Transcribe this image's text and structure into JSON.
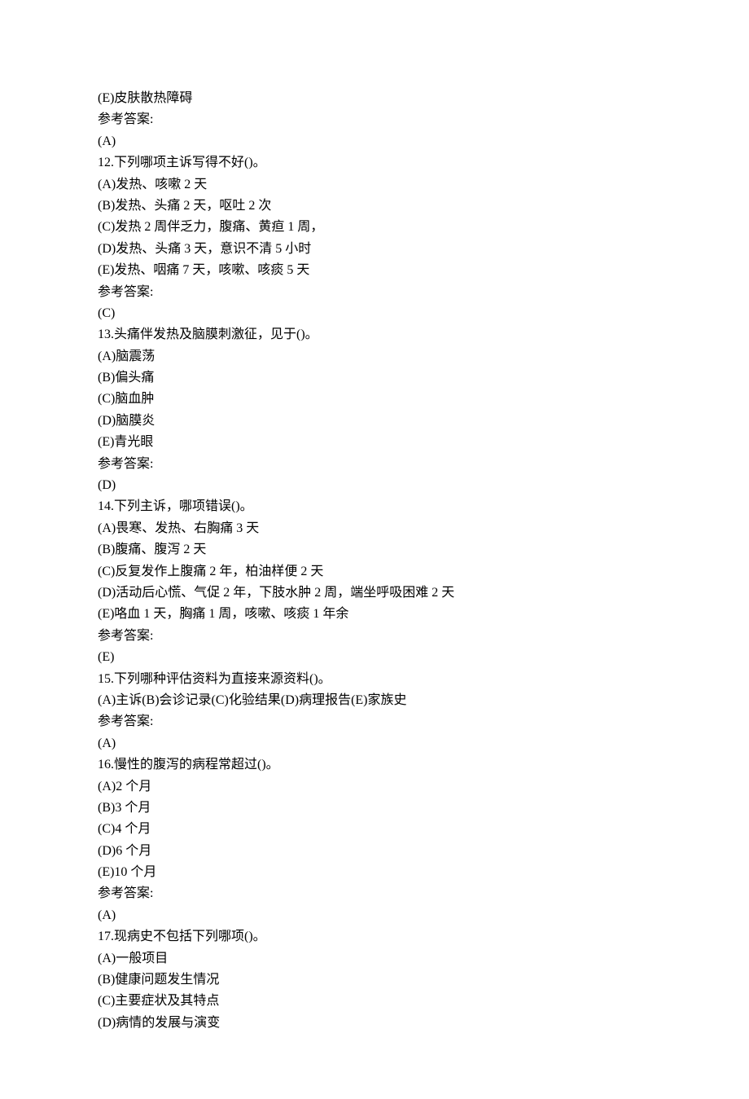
{
  "lines": [
    "(E)皮肤散热障碍",
    "参考答案:",
    "(A)",
    "12.下列哪项主诉写得不好()。",
    "(A)发热、咳嗽 2 天",
    "(B)发热、头痛 2 天，呕吐 2 次",
    "(C)发热 2 周伴乏力，腹痛、黄疸 1 周，",
    "(D)发热、头痛 3 天，意识不清 5 小时",
    "(E)发热、咽痛 7 天，咳嗽、咳痰 5 天",
    "参考答案:",
    "(C)",
    "13.头痛伴发热及脑膜刺激征，见于()。",
    "(A)脑震荡",
    "(B)偏头痛",
    "(C)脑血肿",
    "(D)脑膜炎",
    "(E)青光眼",
    "参考答案:",
    "(D)",
    "14.下列主诉，哪项错误()。",
    "(A)畏寒、发热、右胸痛 3 天",
    "(B)腹痛、腹泻 2 天",
    "(C)反复发作上腹痛 2 年，柏油样便 2 天",
    "(D)活动后心慌、气促 2 年，下肢水肿 2 周，端坐呼吸困难 2 天",
    "(E)咯血 1 天，胸痛 1 周，咳嗽、咳痰 1 年余",
    "参考答案:",
    "(E)",
    "15.下列哪种评估资料为直接来源资料()。",
    "(A)主诉(B)会诊记录(C)化验结果(D)病理报告(E)家族史",
    "参考答案:",
    "(A)",
    "16.慢性的腹泻的病程常超过()。",
    "(A)2 个月",
    "(B)3 个月",
    "(C)4 个月",
    "(D)6 个月",
    "(E)10 个月",
    "参考答案:",
    "(A)",
    "17.现病史不包括下列哪项()。",
    "(A)一般项目",
    "(B)健康问题发生情况",
    "(C)主要症状及其特点",
    "(D)病情的发展与演变"
  ]
}
